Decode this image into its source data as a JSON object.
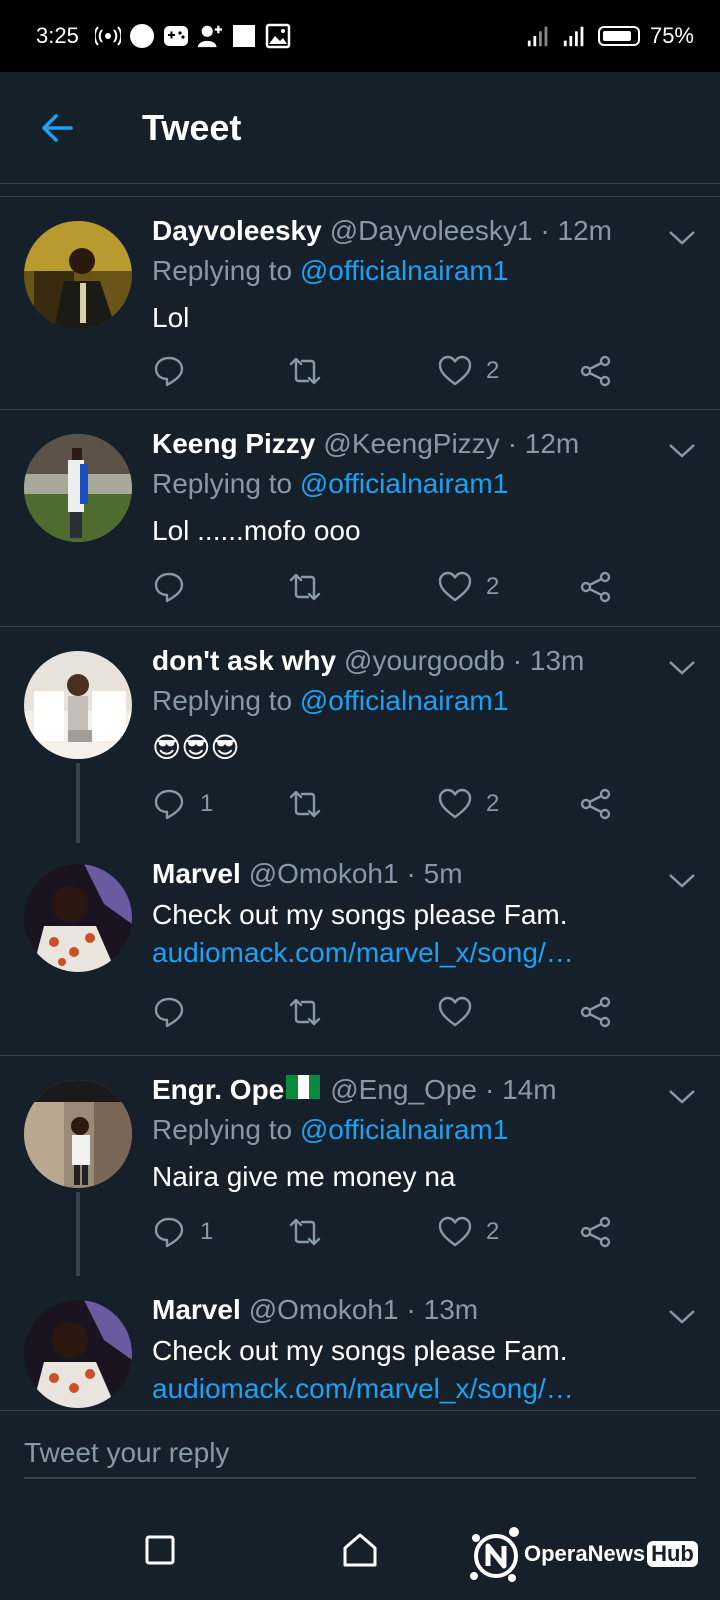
{
  "status_bar": {
    "time": "3:25",
    "battery": "75%"
  },
  "header": {
    "title": "Tweet"
  },
  "tweets": [
    {
      "name": "Dayvoleesky",
      "handle": "@Dayvoleesky1",
      "time": "· 12m",
      "replying_label": "Replying to",
      "replying_to": "@officialnairam1",
      "text": "Lol",
      "replies": "",
      "likes": "2"
    },
    {
      "name": "Keeng Pizzy",
      "handle": "@KeengPizzy",
      "time": "· 12m",
      "replying_label": "Replying to",
      "replying_to": "@officialnairam1",
      "text": "Lol ......mofo ooo",
      "replies": "",
      "likes": "2"
    },
    {
      "name": "don't ask why",
      "handle": "@yourgoodb",
      "time": "· 13m",
      "replying_label": "Replying to",
      "replying_to": "@officialnairam1",
      "text": "😎😎😎",
      "replies": "1",
      "likes": "2"
    },
    {
      "name": "Marvel",
      "handle": "@Omokoh1",
      "time": "· 5m",
      "text": "Check out my songs please Fam.",
      "link": "audiomack.com/marvel_x/song/…",
      "replies": "",
      "likes": ""
    },
    {
      "name": "Engr. Ope",
      "handle": "@Eng_Ope",
      "time": "· 14m",
      "replying_label": "Replying to",
      "replying_to": "@officialnairam1",
      "text": "Naira give me money na",
      "replies": "1",
      "likes": "2"
    },
    {
      "name": "Marvel",
      "handle": "@Omokoh1",
      "time": "· 13m",
      "text": "Check out my songs please Fam.",
      "link": "audiomack.com/marvel_x/song/…"
    }
  ],
  "composer": {
    "placeholder": "Tweet your reply"
  },
  "watermark": {
    "text": "OperaNews",
    "badge": "Hub"
  },
  "colors": {
    "background": "#15202b",
    "accent": "#1da1f2",
    "muted": "#8899a6",
    "divider": "#38444d"
  }
}
